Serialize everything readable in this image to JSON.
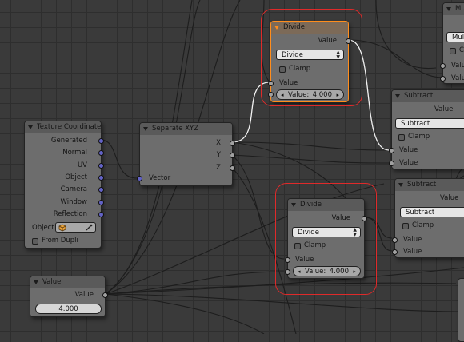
{
  "nodes": {
    "texture_coordinate": {
      "title": "Texture Coordinate",
      "outputs": [
        "Generated",
        "Normal",
        "UV",
        "Object",
        "Camera",
        "Window",
        "Reflection"
      ],
      "object_label": "Object",
      "from_dupli_label": "From Dupli"
    },
    "separate_xyz": {
      "title": "Separate XYZ",
      "outputs": [
        "X",
        "Y",
        "Z"
      ],
      "input": "Vector"
    },
    "divide_top": {
      "title": "Divide",
      "output": "Value",
      "operation": "Divide",
      "clamp_label": "Clamp",
      "input_label": "Value",
      "field_label": "Value:",
      "field_value": "4.000"
    },
    "divide_bottom": {
      "title": "Divide",
      "output": "Value",
      "operation": "Divide",
      "clamp_label": "Clamp",
      "input_label": "Value",
      "field_label": "Value:",
      "field_value": "4.000"
    },
    "subtract_top": {
      "title": "Subtract",
      "output": "Value",
      "operation": "Subtract",
      "clamp_label": "Clamp",
      "input_a": "Value",
      "input_b": "Value"
    },
    "subtract_bottom": {
      "title": "Subtract",
      "output": "Value",
      "operation": "Subtract",
      "clamp_label": "Clamp",
      "input_a": "Value",
      "input_b": "Value"
    },
    "value": {
      "title": "Value",
      "output": "Value",
      "field_value": "4.000"
    },
    "multiply_partial": {
      "title": "Mu",
      "operation": "Mult",
      "clamp_label": "C",
      "input_a": "Valu",
      "input_b": "Valu"
    }
  },
  "colors": {
    "background": "#3a3a3a",
    "node_body": "#6d6d6d",
    "active_outline": "#ff8d1c",
    "annotation_red": "#e02a2a",
    "vector_socket": "#6363c7",
    "float_socket": "#a1a1a1"
  },
  "icons": {
    "collapse": "triangle-down-icon",
    "object": "cube-icon",
    "eyedropper": "eyedropper-icon"
  }
}
